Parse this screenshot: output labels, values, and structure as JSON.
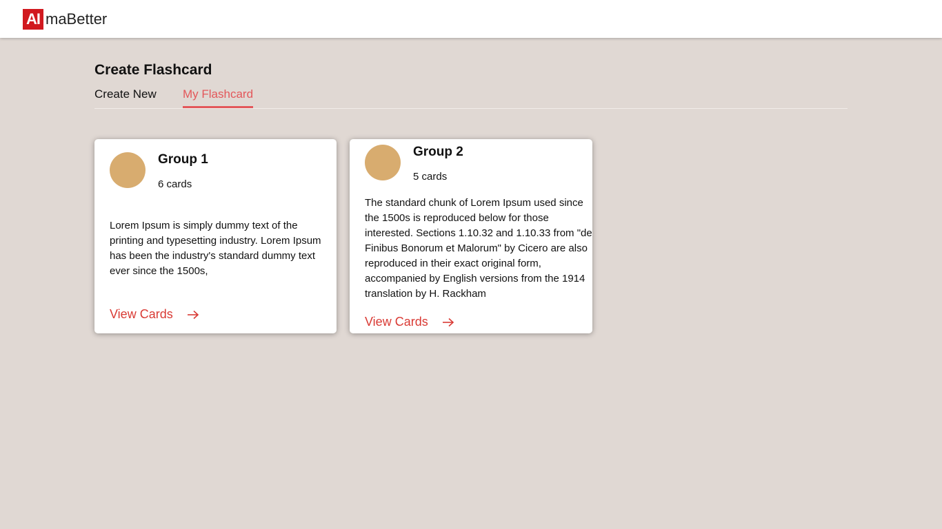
{
  "header": {
    "logo_badge": "AI",
    "logo_text": "maBetter"
  },
  "page": {
    "title": "Create Flashcard"
  },
  "tabs": [
    {
      "label": "Create New",
      "active": false
    },
    {
      "label": "My Flashcard",
      "active": true
    }
  ],
  "groups": [
    {
      "name": "Group 1",
      "count": "6 cards",
      "description": "Lorem Ipsum is simply dummy text of the printing and typesetting industry. Lorem Ipsum has been the industry's standard dummy text ever since the 1500s,",
      "link_label": "View Cards",
      "link_icon": "arrow-right-icon"
    },
    {
      "name": "Group 2",
      "count": "5 cards",
      "description": "The standard chunk of Lorem Ipsum used since the 1500s is reproduced below for those interested. Sections 1.10.32 and 1.10.33 from \"de Finibus Bonorum et Malorum\" by Cicero are also reproduced in their exact original form, accompanied by English versions from the 1914 translation by H. Rackham",
      "link_label": "View Cards",
      "link_icon": "arrow-right-icon"
    }
  ],
  "colors": {
    "brand_red": "#d1191f",
    "accent": "#e3575a",
    "link": "#d93a34",
    "avatar": "#d8ac6f",
    "background": "#e0d8d3"
  }
}
